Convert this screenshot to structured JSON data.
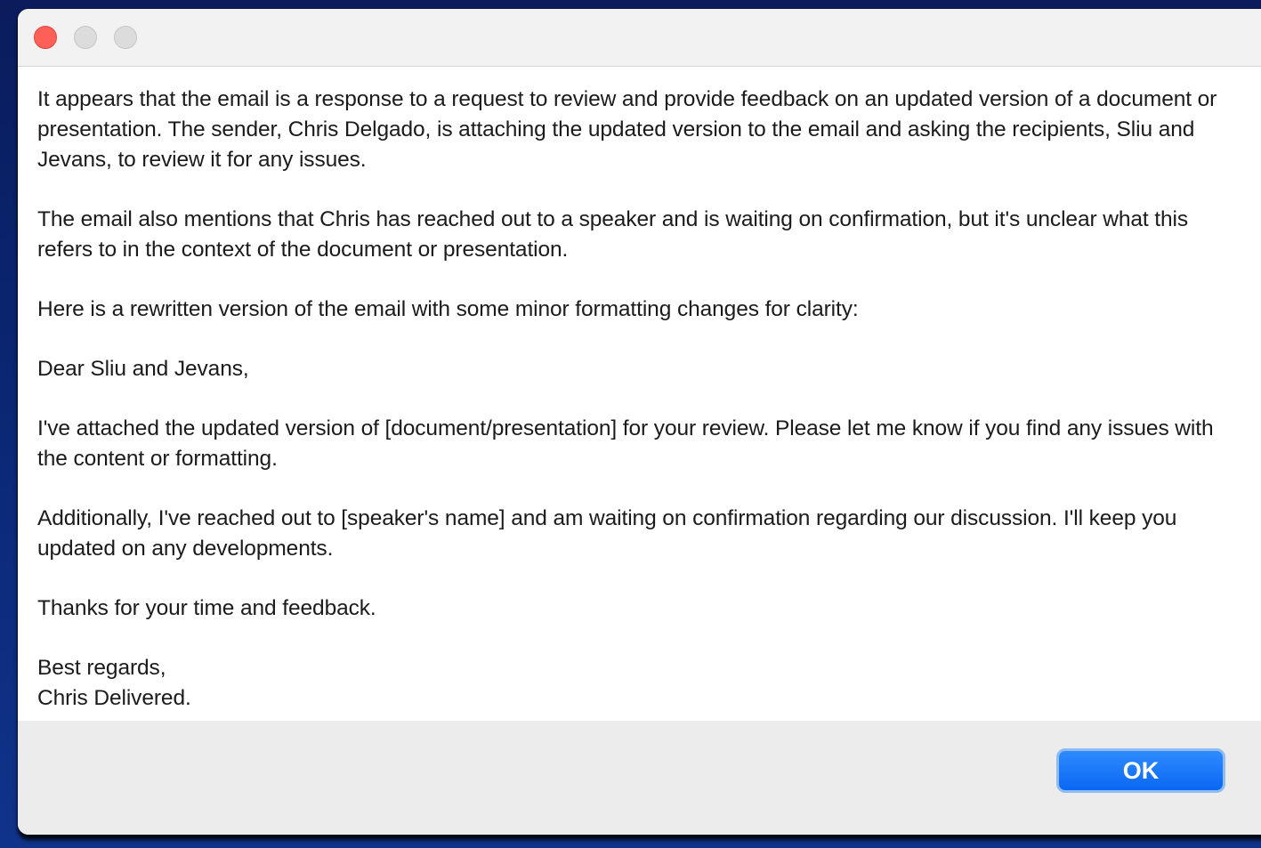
{
  "window": {
    "controls": [
      {
        "name": "close",
        "color": "#fe5f57"
      },
      {
        "name": "minimize",
        "color": "#dcdcdc"
      },
      {
        "name": "zoom",
        "color": "#dcdcdc"
      }
    ]
  },
  "message": {
    "paragraphs": [
      "It appears that the email is a response to a request to review and provide feedback on an updated version of a document or presentation. The sender, Chris Delgado, is attaching the updated version to the email and asking the recipients, Sliu and Jevans, to review it for any issues.",
      "The email also mentions that Chris has reached out to a speaker and is waiting on confirmation, but it's unclear what this refers to in the context of the document or presentation.",
      "Here is a rewritten version of the email with some minor formatting changes for clarity:",
      "Dear Sliu and Jevans,",
      "I've attached the updated version of [document/presentation] for your review. Please let me know if you find any issues with the content or formatting.",
      "Additionally, I've reached out to [speaker's name] and am waiting on confirmation regarding our discussion. I'll keep you updated on any developments.",
      "Thanks for your time and feedback."
    ],
    "signature": {
      "closing": "Best regards,",
      "name": "Chris Delivered."
    }
  },
  "footer": {
    "ok_label": "OK"
  },
  "colors": {
    "accent": "#0a67f2",
    "desktop": "#0b2a7a"
  }
}
